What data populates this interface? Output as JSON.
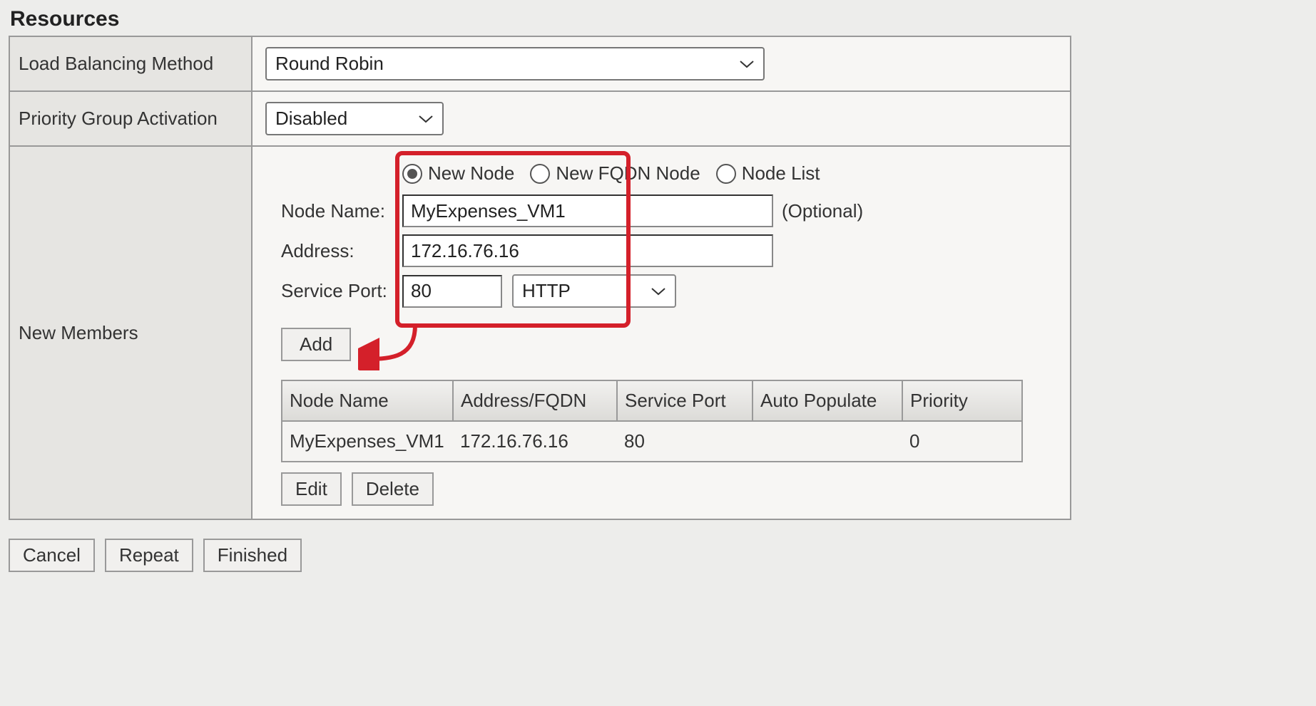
{
  "section_title": "Resources",
  "rows": {
    "lb_method": {
      "label": "Load Balancing Method",
      "value": "Round Robin"
    },
    "pga": {
      "label": "Priority Group Activation",
      "value": "Disabled"
    },
    "new_members": {
      "label": "New Members"
    }
  },
  "node_type": {
    "options": [
      "New Node",
      "New FQDN Node",
      "Node List"
    ],
    "selected": "New Node"
  },
  "node_form": {
    "node_name_label": "Node Name:",
    "node_name_value": "MyExpenses_VM1",
    "node_name_note": "(Optional)",
    "address_label": "Address:",
    "address_value": "172.16.76.16",
    "service_port_label": "Service Port:",
    "service_port_value": "80",
    "service_port_proto": "HTTP"
  },
  "add_btn": "Add",
  "members_table": {
    "headers": [
      "Node Name",
      "Address/FQDN",
      "Service Port",
      "Auto Populate",
      "Priority"
    ],
    "rows": [
      {
        "name": "MyExpenses_VM1",
        "addr": "172.16.76.16",
        "port": "80",
        "auto": "",
        "priority": "0"
      }
    ]
  },
  "member_actions": {
    "edit": "Edit",
    "delete": "Delete"
  },
  "footer": {
    "cancel": "Cancel",
    "repeat": "Repeat",
    "finished": "Finished"
  }
}
